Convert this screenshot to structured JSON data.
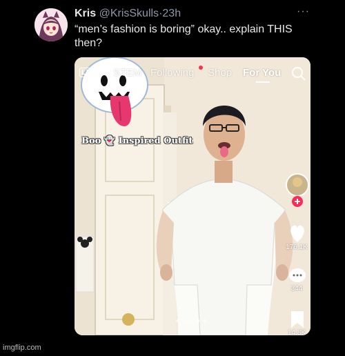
{
  "tweet": {
    "display_name": "Kris",
    "handle": "@KrisSkulls",
    "separator": "·",
    "time": "23h",
    "more": "···",
    "text": "“men’s fashion is boring” okay.. explain THIS then?"
  },
  "tiktok": {
    "live_label": "LIVE",
    "tabs": [
      {
        "label": "STEM",
        "active": false
      },
      {
        "label": "Following",
        "active": false
      },
      {
        "label": "Shop",
        "active": false
      },
      {
        "label": "For You",
        "active": true
      }
    ],
    "caption": "Boo 👻 Inspired Outfit",
    "likes": "176.1K",
    "comments": "344",
    "saves": "14.8K",
    "carousel_dots": 5,
    "carousel_active": 3
  },
  "watermark": "imgflip.com",
  "colors": {
    "background": "#000000",
    "text": "#e7e9ea",
    "muted": "#8b98a5",
    "tiktok_red": "#fe2c55"
  }
}
